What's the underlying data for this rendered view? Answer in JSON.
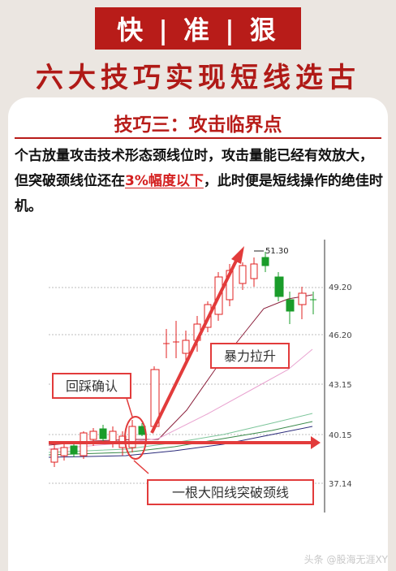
{
  "banner": {
    "text": "快 | 准 | 狠"
  },
  "subtitle": "六大技巧实现短线选古",
  "section_title": "技巧三：攻击临界点",
  "body": {
    "part1": "个古放量攻击技术形态颈线位时，攻击量能已经有效放大，但突破颈线位还在",
    "highlight": "3%幅度以下",
    "part2": "，此时便是短线操作的绝佳时机。"
  },
  "chart": {
    "peak_label": "51.30",
    "price_ticks": [
      "49.20",
      "46.20",
      "43.15",
      "40.15",
      "37.14"
    ],
    "annotations": {
      "violent_rise": "暴力拉升",
      "pullback_confirm": "回踩确认",
      "neckline_break": "一根大阳线突破颈线"
    },
    "colors": {
      "up": "#e02020",
      "down": "#1a9c2a",
      "arrow": "#e23b3b"
    }
  },
  "watermark": "头条 @股海无涯XY"
}
